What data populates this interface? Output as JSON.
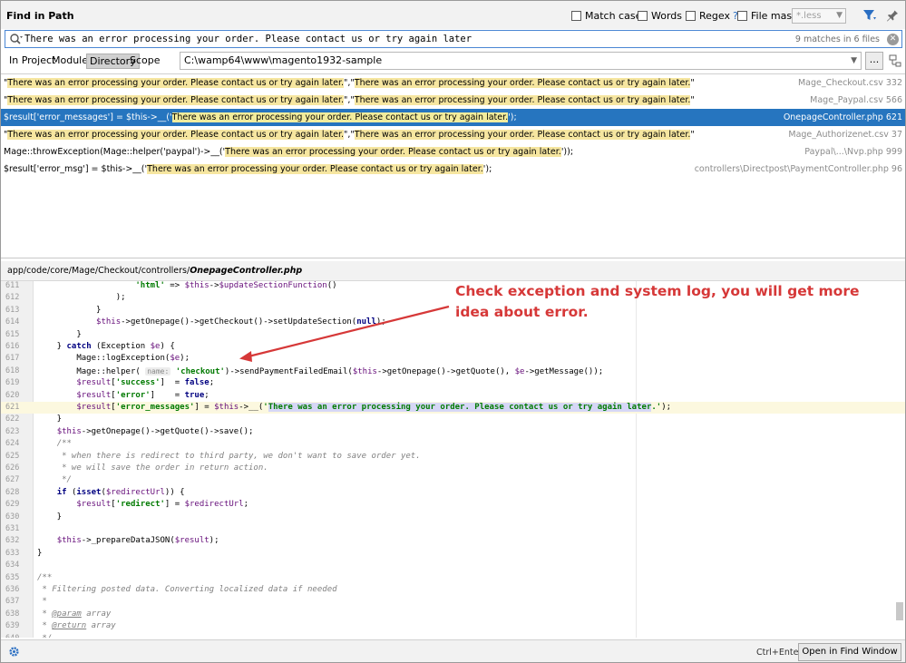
{
  "header": {
    "title": "Find in Path",
    "options": [
      {
        "label": "Match case"
      },
      {
        "label": "Words"
      },
      {
        "label": "Regex"
      },
      {
        "label": "File mask:"
      }
    ],
    "regex_help": "?",
    "file_mask_placeholder": "*.less"
  },
  "search": {
    "query": "There was an error processing your order. Please contact us or try again later",
    "match_count": "9 matches in 6 files"
  },
  "scope": {
    "tabs": [
      "In Project",
      "Module",
      "Directory",
      "Scope"
    ],
    "active_tab": "Directory",
    "directory": "C:\\wamp64\\www\\magento1932-sample",
    "browse_label": "..."
  },
  "results": [
    {
      "prefix": "",
      "pre": "\"",
      "match": "There was an error processing your order. Please contact us or try again later.",
      "mid": "\",\"",
      "match2": "There was an error processing your order. Please contact us or try again later.",
      "post": "\"",
      "file": "Mage_Checkout.csv 332"
    },
    {
      "prefix": "",
      "pre": "\"",
      "match": "There was an error processing your order. Please contact us or try again later.",
      "mid": "\",\"",
      "match2": "There was an error processing your order. Please contact us or try again later.",
      "post": "\"",
      "file": "Mage_Paypal.csv 566"
    },
    {
      "prefix": "$result['error_messages'] = $this->__('",
      "pre": "",
      "match": "There was an error processing your order. Please contact us or try again later.",
      "mid": "');",
      "match2": "",
      "post": "",
      "file": "OnepageController.php 621"
    },
    {
      "prefix": "",
      "pre": "\"",
      "match": "There was an error processing your order. Please contact us or try again later.",
      "mid": "\",\"",
      "match2": "There was an error processing your order. Please contact us or try again later.",
      "post": "\"",
      "file": "Mage_Authorizenet.csv 37"
    },
    {
      "prefix": "Mage::throwException(Mage::helper('paypal')->__('",
      "pre": "",
      "match": "There was an error processing your order. Please contact us or try again later.",
      "mid": "'));",
      "match2": "",
      "post": "",
      "file": "Paypal\\...\\Nvp.php 999"
    },
    {
      "prefix": "$result['error_msg'] = $this->__('",
      "pre": "",
      "match": "There was an error processing your order. Please contact us or try again later.",
      "mid": "');",
      "match2": "",
      "post": "",
      "file": "controllers\\Directpost\\PaymentController.php 96"
    }
  ],
  "preview": {
    "path_prefix": "app/code/core/Mage/Checkout/controllers/",
    "path_file": "OnepageController.php"
  },
  "code": [
    {
      "n": "611",
      "html": "                    <span class='s'>'html'</span> => <span class='v'>$this</span>-><span class='v'>$updateSectionFunction</span>()"
    },
    {
      "n": "612",
      "html": "                );"
    },
    {
      "n": "613",
      "html": "            }"
    },
    {
      "n": "614",
      "html": "            <span class='v'>$this</span>->getOnepage()->getCheckout()->setUpdateSection(<span class='k'>null</span>);"
    },
    {
      "n": "615",
      "html": "        }"
    },
    {
      "n": "616",
      "html": "    } <span class='k'>catch</span> (Exception <span class='v'>$e</span>) {"
    },
    {
      "n": "617",
      "html": "        Mage::logException(<span class='v'>$e</span>);"
    },
    {
      "n": "618",
      "html": "        Mage::helper( <span class='hint'>name:</span> <span class='s'>'checkout'</span>)->sendPaymentFailedEmail(<span class='v'>$this</span>->getOnepage()->getQuote(), <span class='v'>$e</span>->getMessage());"
    },
    {
      "n": "619",
      "html": "        <span class='v'>$result</span>[<span class='s'>'success'</span>]  = <span class='k'>false</span>;"
    },
    {
      "n": "620",
      "html": "        <span class='v'>$result</span>[<span class='s'>'error'</span>]    = <span class='k'>true</span>;"
    },
    {
      "n": "621",
      "html": "        <span class='v'>$result</span>[<span class='s'>'error_messages'</span>] = <span class='v'>$this</span>->__(<span class='s'>'<span class=\"shl\">There was an error processing your order. Please contact us or try again later</span>.'</span>);",
      "current": true
    },
    {
      "n": "622",
      "html": "    }"
    },
    {
      "n": "623",
      "html": "    <span class='v'>$this</span>->getOnepage()->getQuote()->save();"
    },
    {
      "n": "624",
      "html": "    <span class='c'>/**</span>"
    },
    {
      "n": "625",
      "html": "<span class='c'>     * when there is redirect to third party, we don't want to save order yet.</span>"
    },
    {
      "n": "626",
      "html": "<span class='c'>     * we will save the order in return action.</span>"
    },
    {
      "n": "627",
      "html": "<span class='c'>     */</span>"
    },
    {
      "n": "628",
      "html": "    <span class='k'>if</span> (<span class='k'>isset</span>(<span class='v'>$redirectUrl</span>)) {"
    },
    {
      "n": "629",
      "html": "        <span class='v'>$result</span>[<span class='s'>'redirect'</span>] = <span class='v'>$redirectUrl</span>;"
    },
    {
      "n": "630",
      "html": "    }"
    },
    {
      "n": "631",
      "html": ""
    },
    {
      "n": "632",
      "html": "    <span class='v'>$this</span>->_prepareDataJSON(<span class='v'>$result</span>);"
    },
    {
      "n": "633",
      "html": "}"
    },
    {
      "n": "634",
      "html": ""
    },
    {
      "n": "635",
      "html": "<span class='c'>/**</span>"
    },
    {
      "n": "636",
      "html": "<span class='c'> * Filtering posted data. Converting localized data if needed</span>"
    },
    {
      "n": "637",
      "html": "<span class='c'> *</span>"
    },
    {
      "n": "638",
      "html": "<span class='c'> * <u>@param</u> array</span>"
    },
    {
      "n": "639",
      "html": "<span class='c'> * <u>@return</u> array</span>"
    },
    {
      "n": "640",
      "html": "<span class='c'> */</span>"
    }
  ],
  "annotation": "Check exception and system log, you will get more idea about error.",
  "footer": {
    "shortcut": "Ctrl+Enter",
    "open_button": "Open in Find Window"
  },
  "colors": {
    "selection": "#2675bf",
    "match_highlight": "#f6e6a0",
    "annotation": "#d63838"
  }
}
